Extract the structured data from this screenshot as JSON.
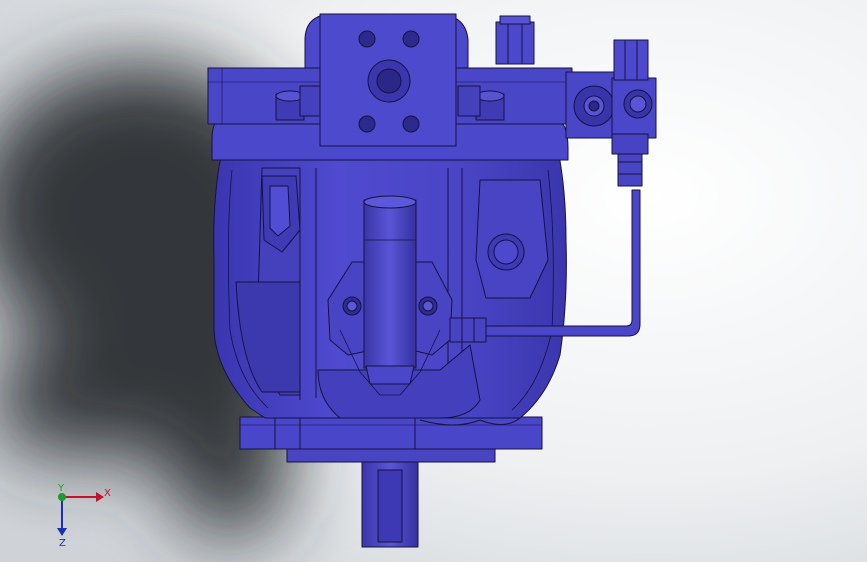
{
  "app": {
    "view": "cad-3d-viewport",
    "model": "hydraulic-pump-assembly",
    "display_style": "shaded-with-edges",
    "colors": {
      "background_top": "#ffffff",
      "background_mid": "#dfe3e6",
      "shadow": "#2b2d30",
      "part_fill": "#4b46c8",
      "part_light": "#6b66dd",
      "part_dark": "#3330a0",
      "edge": "#15133f"
    }
  },
  "triad": {
    "x_label": "X",
    "y_label": "Y",
    "z_label": "Z",
    "x_color": "#c8102e",
    "y_color": "#1c9c2b",
    "z_color": "#1b2fb0"
  }
}
